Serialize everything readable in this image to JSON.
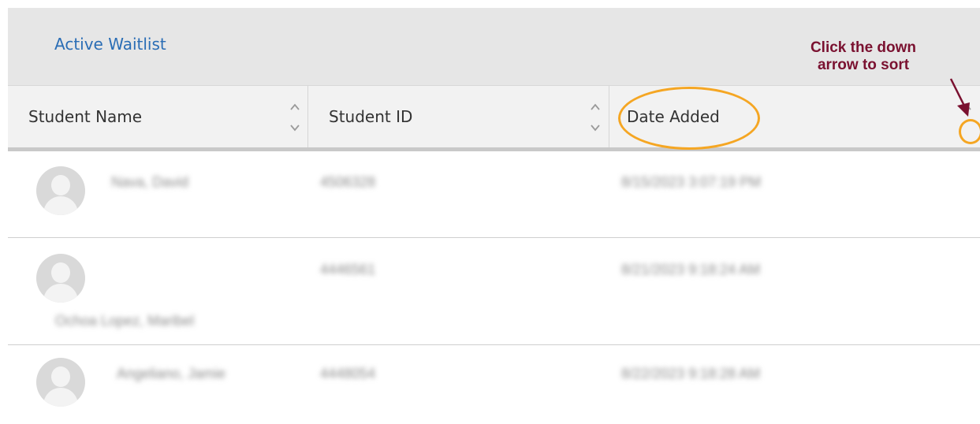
{
  "header": {
    "tab_label": "Active Waitlist"
  },
  "columns": [
    {
      "label": "Student Name"
    },
    {
      "label": "Student ID"
    },
    {
      "label": "Date Added"
    }
  ],
  "annotation": {
    "line1": "Click the down",
    "line2": "arrow to sort",
    "color": "#7a1130",
    "highlight_color": "#f5a623"
  },
  "rows": [
    {
      "name": "Nava, David",
      "id": "4506328",
      "date": "8/15/2023 3:07:19 PM"
    },
    {
      "name": "Ochoa Lopez, Maribel",
      "id": "4446561",
      "date": "8/21/2023 9:18:24 AM"
    },
    {
      "name": "Angeliano, Jamie",
      "id": "4448054",
      "date": "8/22/2023 9:18:28 AM"
    }
  ],
  "colors": {
    "link": "#2a6db5",
    "header_bg": "#e6e6e6",
    "col_header_bg": "#f2f2f2"
  }
}
